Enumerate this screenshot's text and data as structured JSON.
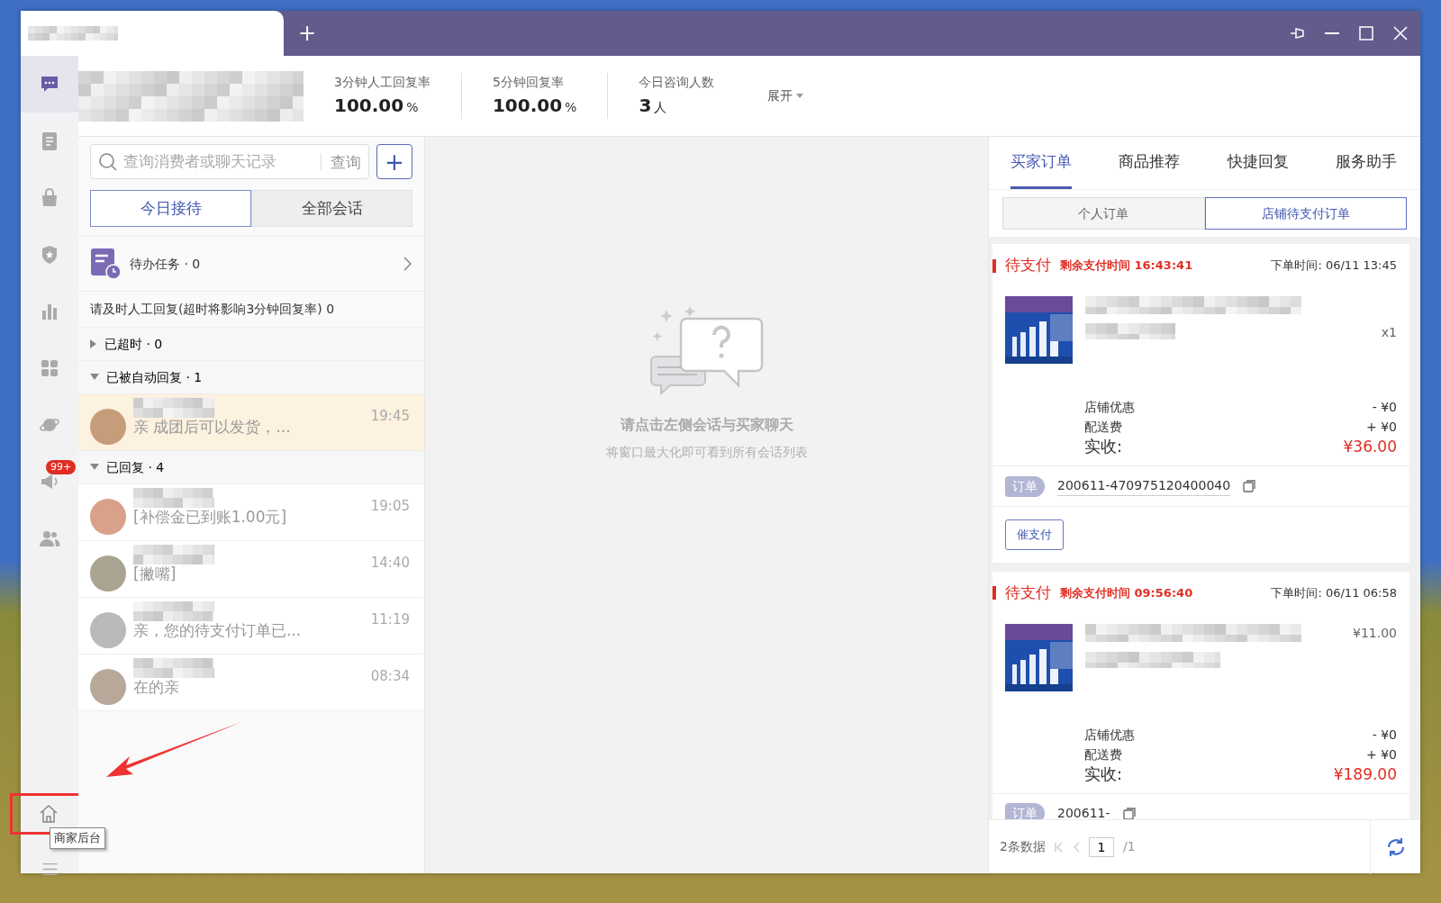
{
  "window": {
    "new_tab": "+"
  },
  "sidebar": {
    "items": [
      {
        "kind": "chat",
        "selected": true
      },
      {
        "kind": "document",
        "selected": false
      },
      {
        "kind": "bag",
        "selected": false
      },
      {
        "kind": "shield",
        "selected": false
      },
      {
        "kind": "chart",
        "selected": false
      },
      {
        "kind": "apps",
        "selected": false
      },
      {
        "kind": "planet",
        "selected": false
      },
      {
        "kind": "megaphone",
        "selected": false,
        "badge": "99+"
      },
      {
        "kind": "users",
        "selected": false
      }
    ],
    "bottom_items": [
      {
        "kind": "home",
        "tooltip": "商家后台"
      },
      {
        "kind": "menu"
      }
    ]
  },
  "stats": [
    {
      "label": "3分钟人工回复率",
      "value": "100.00",
      "unit": "%"
    },
    {
      "label": "5分钟回复率",
      "value": "100.00",
      "unit": "%"
    },
    {
      "label": "今日咨询人数",
      "value": "3",
      "unit": "人"
    }
  ],
  "expand": "展开",
  "search": {
    "placeholder": "查询消费者或聊天记录",
    "button": "查询",
    "add": "+"
  },
  "conversation_tabs": [
    {
      "label": "今日接待",
      "selected": true
    },
    {
      "label": "全部会话",
      "selected": false
    }
  ],
  "todo": {
    "label": "待办任务 · 0"
  },
  "notice": "请及时人工回复(超时将影响3分钟回复率) 0",
  "groups": [
    {
      "label": "已超时 · 0",
      "expanded": false
    },
    {
      "label": "已被自动回复 · 1",
      "expanded": true,
      "conversations": [
        {
          "time": "19:45",
          "preview": "亲  成团后可以发货，...",
          "selected": true
        }
      ]
    },
    {
      "label": "已回复 · 4",
      "expanded": true,
      "conversations": [
        {
          "time": "19:05",
          "preview": "[补偿金已到账1.00元]",
          "selected": false
        },
        {
          "time": "14:40",
          "preview": "[撇嘴]",
          "selected": false
        },
        {
          "time": "11:19",
          "preview": "亲，您的待支付订单已...",
          "selected": false
        },
        {
          "time": "08:34",
          "preview": "在的亲",
          "selected": false
        }
      ]
    }
  ],
  "empty_state": {
    "title": "请点击左侧会话与买家聊天",
    "hint": "将窗口最大化即可看到所有会话列表"
  },
  "right_tabs": [
    {
      "label": "买家订单",
      "selected": true
    },
    {
      "label": "商品推荐",
      "selected": false
    },
    {
      "label": "快捷回复",
      "selected": false
    },
    {
      "label": "服务助手",
      "selected": false
    }
  ],
  "order_tabs": [
    {
      "label": "个人订单",
      "selected": false
    },
    {
      "label": "店铺待支付订单",
      "selected": true
    }
  ],
  "orders": [
    {
      "status": "待支付",
      "countdown": "剩余支付时间 16:43:41",
      "order_time": "下单时间: 06/11 13:45",
      "quantity": "x1",
      "discount_label": "店铺优惠",
      "discount": "- ¥0",
      "shipping_label": "配送费",
      "shipping": "+ ¥0",
      "total_label": "实收:",
      "total": "¥36.00",
      "order_label": "订单",
      "order_no": "200611-470975120400040",
      "action": "催支付"
    },
    {
      "status": "待支付",
      "countdown": "剩余支付时间 09:56:40",
      "order_time": "下单时间: 06/11 06:58",
      "price": "¥11.00",
      "discount_label": "店铺优惠",
      "discount": "- ¥0",
      "shipping_label": "配送费",
      "shipping": "+ ¥0",
      "total_label": "实收:",
      "total": "¥189.00",
      "order_label": "订单",
      "order_no": "200611-"
    }
  ],
  "pager": {
    "count": "2条数据",
    "page": "1",
    "total_pages": "/1"
  }
}
